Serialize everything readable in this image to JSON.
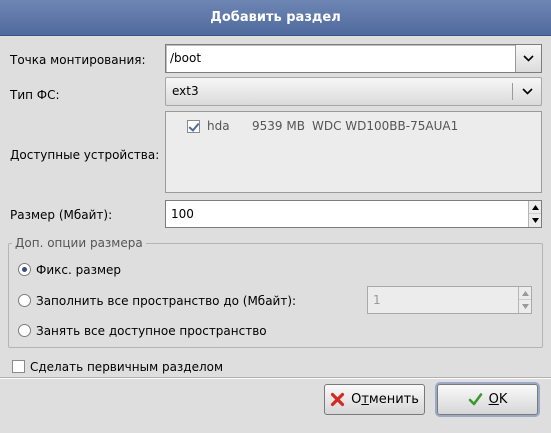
{
  "window": {
    "title": "Добавить раздел"
  },
  "form": {
    "mount_label": "Точка монтирования:",
    "mount_value": "/boot",
    "fstype_label": "Тип ФС:",
    "fstype_value": "ext3",
    "devices_label": "Доступные устройства:",
    "devices": [
      {
        "checked": true,
        "name": "hda",
        "size": "9539 MB",
        "model": "WDC WD100BB-75AUA1"
      }
    ],
    "size_label": "Размер (Мбайт):",
    "size_value": "100"
  },
  "size_options": {
    "title": "Доп. опции размера",
    "fixed_label": "Фикс. размер",
    "fill_upto_label": "Заполнить все пространство до (Мбайт):",
    "fill_upto_value": "1",
    "fill_all_label": "Занять все доступное пространство",
    "selected": "fixed"
  },
  "primary": {
    "label": "Сделать первичным разделом",
    "checked": false
  },
  "buttons": {
    "cancel_prefix": "О",
    "cancel_mnemonic": "т",
    "cancel_suffix": "менить",
    "ok_prefix": "",
    "ok_mnemonic": "О",
    "ok_suffix": "K"
  },
  "colors": {
    "title_bar": "#5b74a8",
    "cancel_icon": "#d42a1f",
    "ok_icon": "#3a9a2f"
  }
}
